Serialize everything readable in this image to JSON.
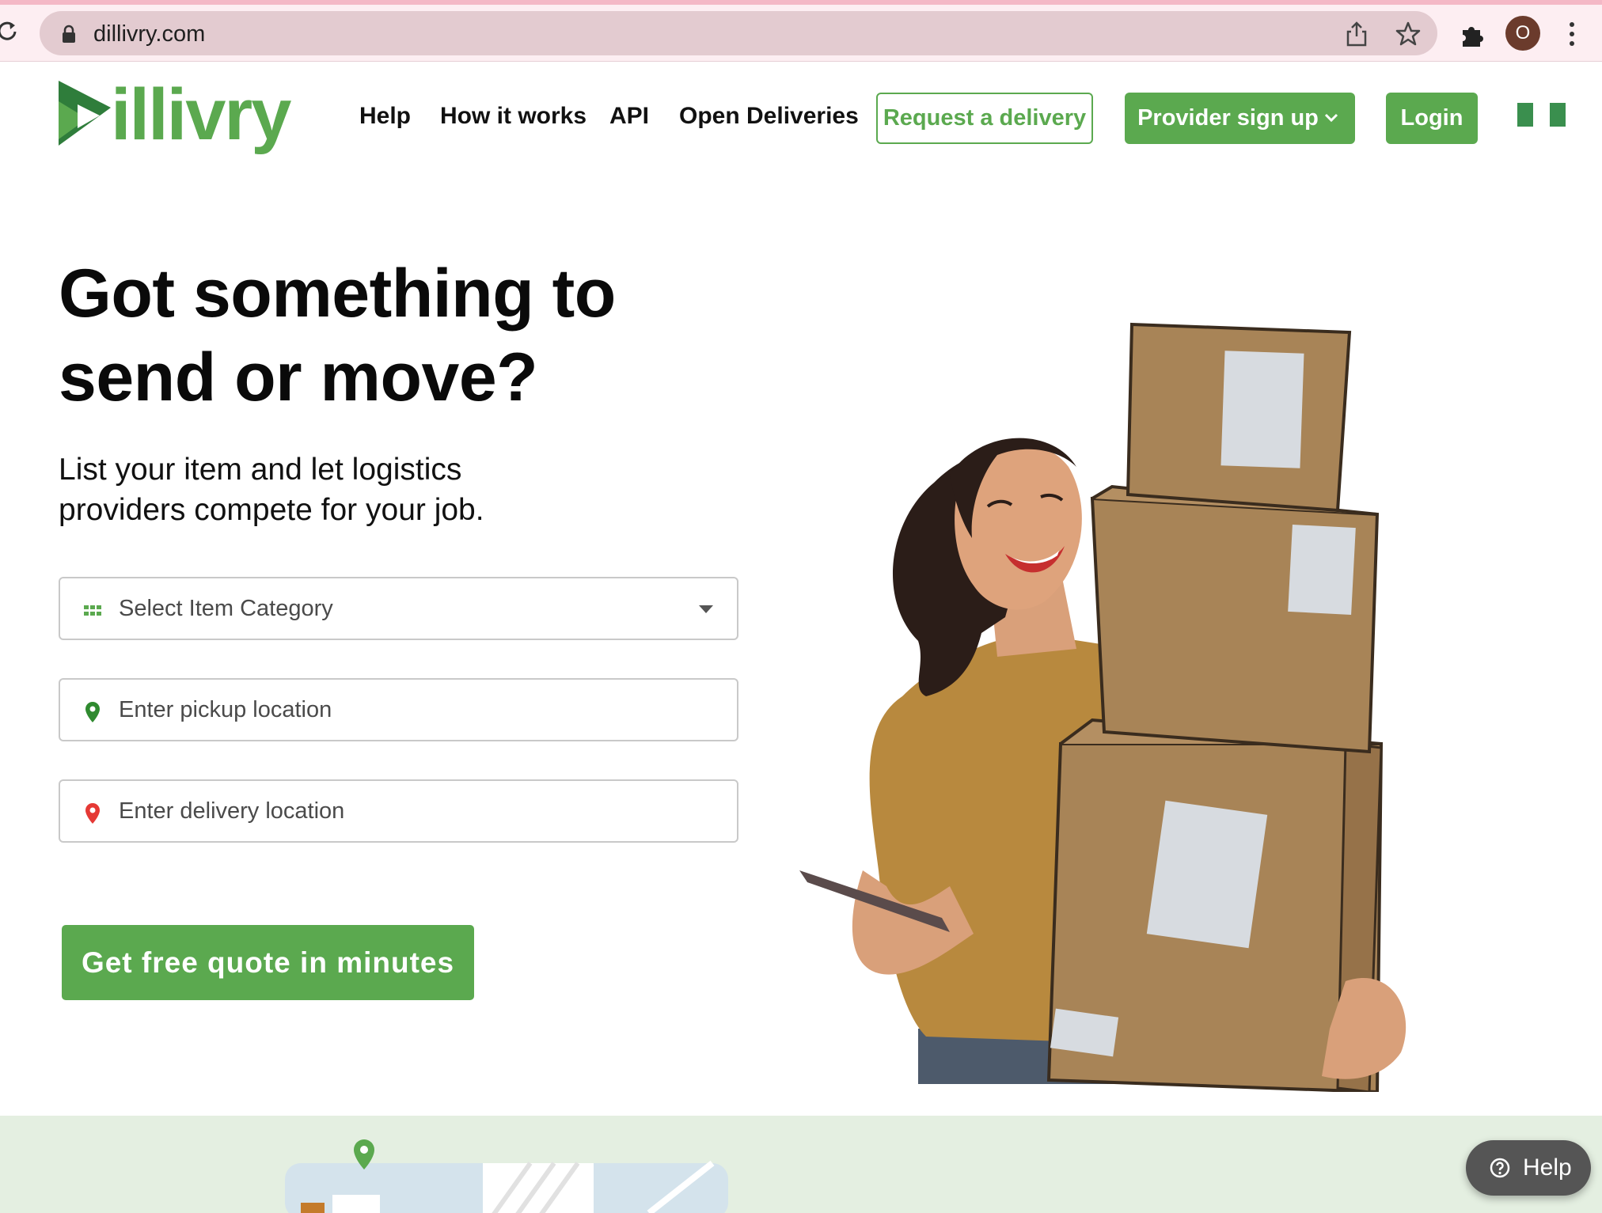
{
  "browser": {
    "url": "dillivry.com",
    "avatar_letter": "O"
  },
  "brand": {
    "logo_text": "dillivry",
    "color_green": "#5ba94f",
    "color_dark_green": "#2f7d3b"
  },
  "nav": {
    "items": [
      {
        "label": "Help"
      },
      {
        "label": "How it works"
      },
      {
        "label": "API"
      },
      {
        "label": "Open Deliveries"
      }
    ],
    "request_label": "Request a delivery",
    "provider_label": "Provider sign up",
    "login_label": "Login"
  },
  "hero": {
    "title_line1": "Got something to",
    "title_line2": "send or move?",
    "subtitle_line1": "List your item and let logistics",
    "subtitle_line2": "providers compete for your job.",
    "category_placeholder": "Select Item Category",
    "pickup_placeholder": "Enter pickup location",
    "delivery_placeholder": "Enter delivery location",
    "cta_label": "Get free quote in minutes"
  },
  "floating": {
    "help_label": "Help"
  },
  "icons": {
    "reload": "reload-icon",
    "lock": "lock-icon",
    "share": "share-icon",
    "bookmark": "star-icon",
    "extensions": "puzzle-icon",
    "menu": "kebab-menu-icon",
    "category": "grid-icon",
    "pickup": "green-pin-icon",
    "delivery": "red-pin-icon",
    "help": "question-circle-icon"
  }
}
